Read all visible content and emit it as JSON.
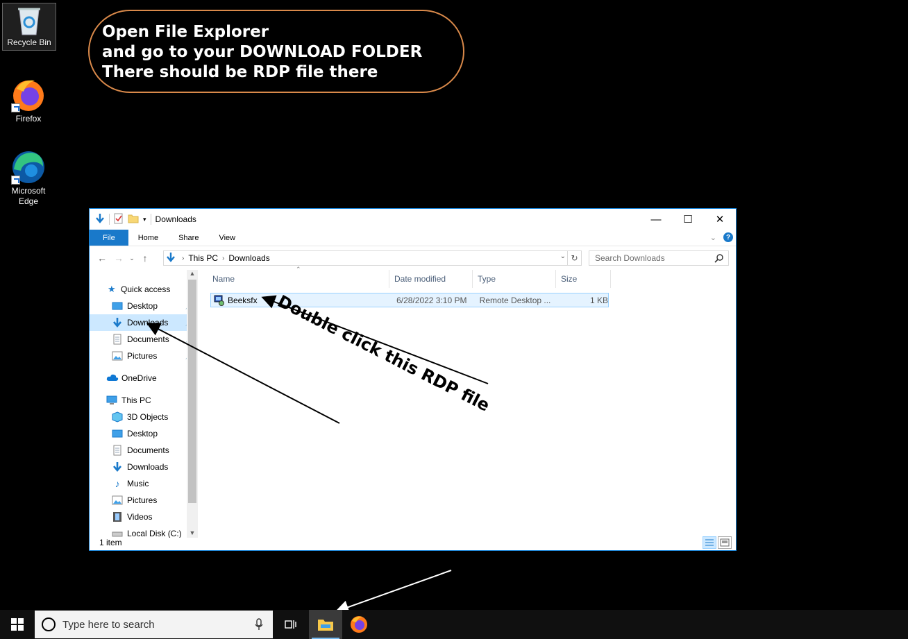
{
  "desktop": {
    "icons": [
      {
        "label": "Recycle Bin"
      },
      {
        "label": "Firefox"
      },
      {
        "label": "Microsoft Edge"
      }
    ]
  },
  "callout": {
    "line1": "Open File Explorer",
    "line2": "and go to your DOWNLOAD FOLDER",
    "line3": "There should be RDP file there"
  },
  "annotation": {
    "text": "Double click this RDP file"
  },
  "explorer": {
    "title": "Downloads",
    "ribbon_tabs": [
      "File",
      "Home",
      "Share",
      "View"
    ],
    "address": {
      "root": "This PC",
      "current": "Downloads"
    },
    "search_placeholder": "Search Downloads",
    "nav": {
      "quick_access": "Quick access",
      "quick_items": [
        "Desktop",
        "Downloads",
        "Documents",
        "Pictures"
      ],
      "onedrive": "OneDrive",
      "this_pc": "This PC",
      "pc_items": [
        "3D Objects",
        "Desktop",
        "Documents",
        "Downloads",
        "Music",
        "Pictures",
        "Videos",
        "Local Disk (C:)"
      ]
    },
    "columns": [
      "Name",
      "Date modified",
      "Type",
      "Size"
    ],
    "files": [
      {
        "name": "Beeksfx",
        "date": "6/28/2022 3:10 PM",
        "type": "Remote Desktop ...",
        "size": "1 KB"
      }
    ],
    "status": "1 item"
  },
  "taskbar": {
    "search_placeholder": "Type here to search"
  },
  "colors": {
    "callout_border": "#d9894a",
    "accent": "#1979ca",
    "selection": "#cce8ff"
  }
}
